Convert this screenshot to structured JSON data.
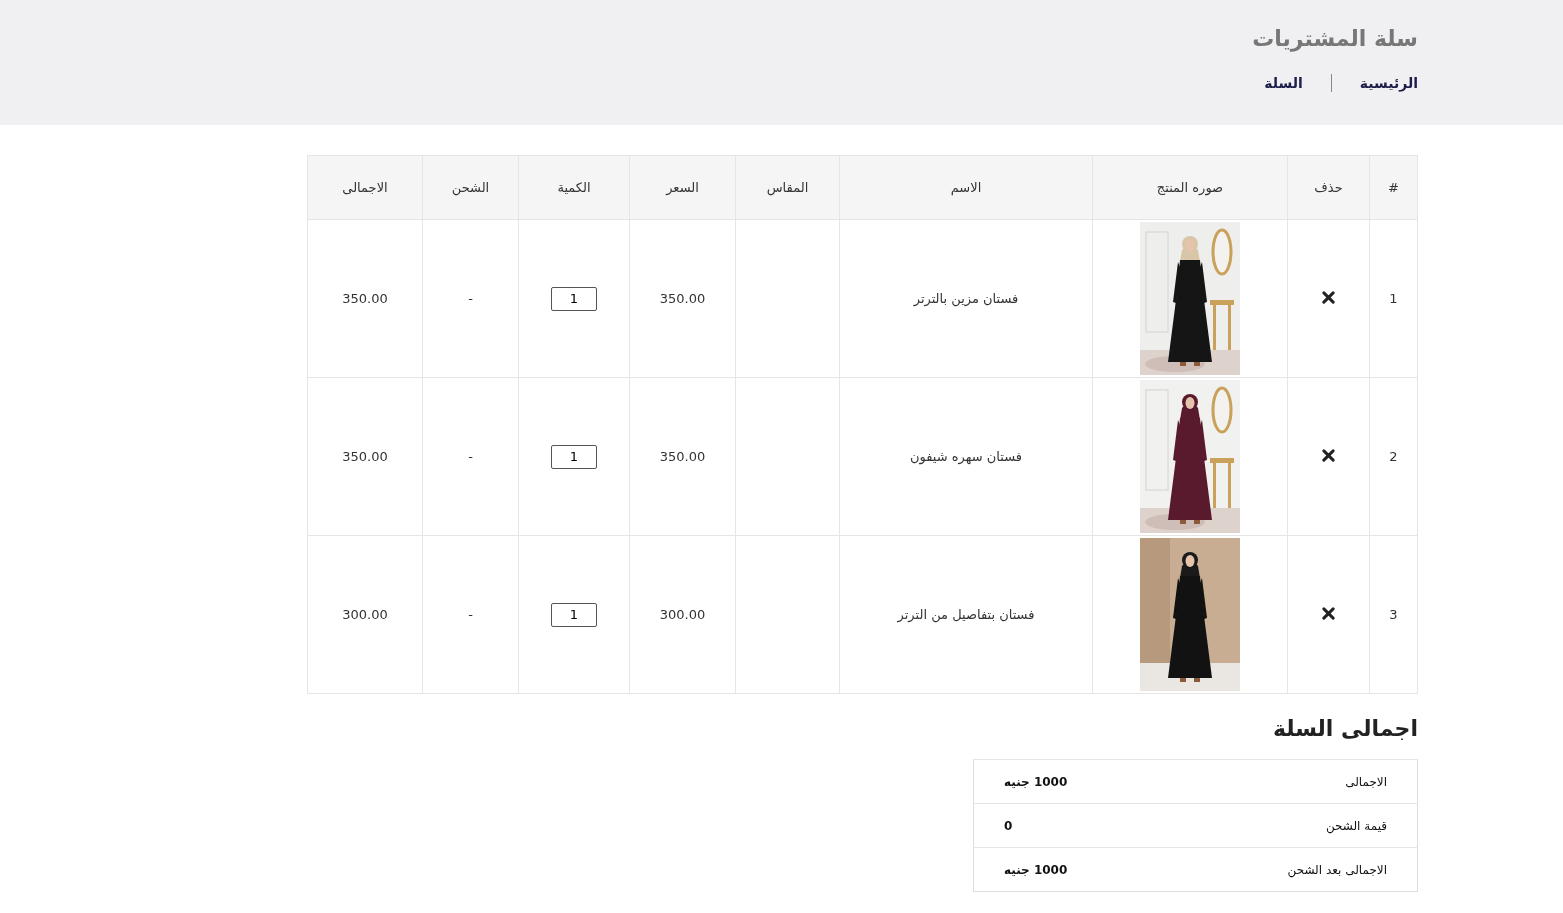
{
  "header": {
    "title": "سلة المشتريات",
    "breadcrumbs": [
      {
        "label": "الرئيسية"
      },
      {
        "label": "السلة"
      }
    ]
  },
  "table": {
    "columns": [
      "#",
      "حذف",
      "صوره المنتج",
      "الاسم",
      "المقاس",
      "السعر",
      "الكمية",
      "الشحن",
      "الاجمالى"
    ],
    "rows": [
      {
        "index": "1",
        "name": "فستان مزين بالترتر",
        "price": "350.00",
        "quantity": "1",
        "shipping": "-",
        "total": "350.00"
      },
      {
        "index": "2",
        "name": "فستان سهره شيفون",
        "price": "350.00",
        "quantity": "1",
        "shipping": "-",
        "total": "350.00"
      },
      {
        "index": "3",
        "name": "فستان بتفاصيل من الترتر",
        "price": "300.00",
        "quantity": "1",
        "shipping": "-",
        "total": "300.00"
      }
    ]
  },
  "summary": {
    "title": "اجمالى السلة",
    "rows": [
      {
        "label": "الاجمالى",
        "value": "1000 جنيه"
      },
      {
        "label": "قيمة الشحن",
        "value": "0"
      },
      {
        "label": "الاجمالى بعد الشحن",
        "value": "1000 جنيه"
      }
    ]
  }
}
